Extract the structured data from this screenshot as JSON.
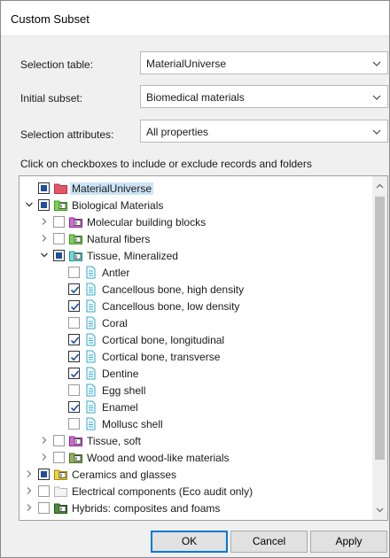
{
  "window": {
    "title": "Custom Subset"
  },
  "form": {
    "selection_table": {
      "label": "Selection table:",
      "value": "MaterialUniverse"
    },
    "initial_subset": {
      "label": "Initial subset:",
      "value": "Biomedical materials"
    },
    "selection_attributes": {
      "label": "Selection attributes:",
      "value": "All properties"
    }
  },
  "hint": "Click on checkboxes to include or exclude records and folders",
  "tree": [
    {
      "label": "MaterialUniverse",
      "level": 0,
      "expander": "none",
      "check": "partial",
      "icon": "red-folder-icon",
      "selected": true
    },
    {
      "label": "Biological Materials",
      "level": 0,
      "expander": "open",
      "check": "partial",
      "icon": "green-folder-icon"
    },
    {
      "label": "Molecular building blocks",
      "level": 1,
      "expander": "closed",
      "check": "off",
      "icon": "purple-folder-icon"
    },
    {
      "label": "Natural fibers",
      "level": 1,
      "expander": "closed",
      "check": "off",
      "icon": "green-folder-icon"
    },
    {
      "label": "Tissue, Mineralized",
      "level": 1,
      "expander": "open",
      "check": "partial",
      "icon": "cyan-folder-icon"
    },
    {
      "label": "Antler",
      "level": 2,
      "expander": "none",
      "check": "off",
      "icon": "record-icon"
    },
    {
      "label": "Cancellous bone, high density",
      "level": 2,
      "expander": "none",
      "check": "checked",
      "icon": "record-icon"
    },
    {
      "label": "Cancellous bone, low density",
      "level": 2,
      "expander": "none",
      "check": "checked",
      "icon": "record-icon"
    },
    {
      "label": "Coral",
      "level": 2,
      "expander": "none",
      "check": "off",
      "icon": "record-icon"
    },
    {
      "label": "Cortical bone, longitudinal",
      "level": 2,
      "expander": "none",
      "check": "checked",
      "icon": "record-icon"
    },
    {
      "label": "Cortical bone, transverse",
      "level": 2,
      "expander": "none",
      "check": "checked",
      "icon": "record-icon"
    },
    {
      "label": "Dentine",
      "level": 2,
      "expander": "none",
      "check": "checked",
      "icon": "record-icon"
    },
    {
      "label": "Egg shell",
      "level": 2,
      "expander": "none",
      "check": "off",
      "icon": "record-icon"
    },
    {
      "label": "Enamel",
      "level": 2,
      "expander": "none",
      "check": "checked",
      "icon": "record-icon"
    },
    {
      "label": "Mollusc shell",
      "level": 2,
      "expander": "none",
      "check": "off",
      "icon": "record-icon"
    },
    {
      "label": "Tissue, soft",
      "level": 1,
      "expander": "closed",
      "check": "off",
      "icon": "purple-folder-icon"
    },
    {
      "label": "Wood and wood-like materials",
      "level": 1,
      "expander": "closed",
      "check": "off",
      "icon": "olive-folder-icon"
    },
    {
      "label": "Ceramics and glasses",
      "level": 0,
      "expander": "closed",
      "check": "partial",
      "icon": "yellow-folder-icon"
    },
    {
      "label": "Electrical components (Eco audit only)",
      "level": 0,
      "expander": "closed",
      "check": "off",
      "icon": "plain-folder-icon"
    },
    {
      "label": "Hybrids: composites and foams",
      "level": 0,
      "expander": "closed",
      "check": "off",
      "icon": "darkgreen-folder-icon"
    }
  ],
  "buttons": {
    "ok": "OK",
    "cancel": "Cancel",
    "apply": "Apply"
  },
  "colors": {
    "accent": "#0078d7",
    "checkmark": "#1e4f9e",
    "selection": "#cce4f7"
  }
}
